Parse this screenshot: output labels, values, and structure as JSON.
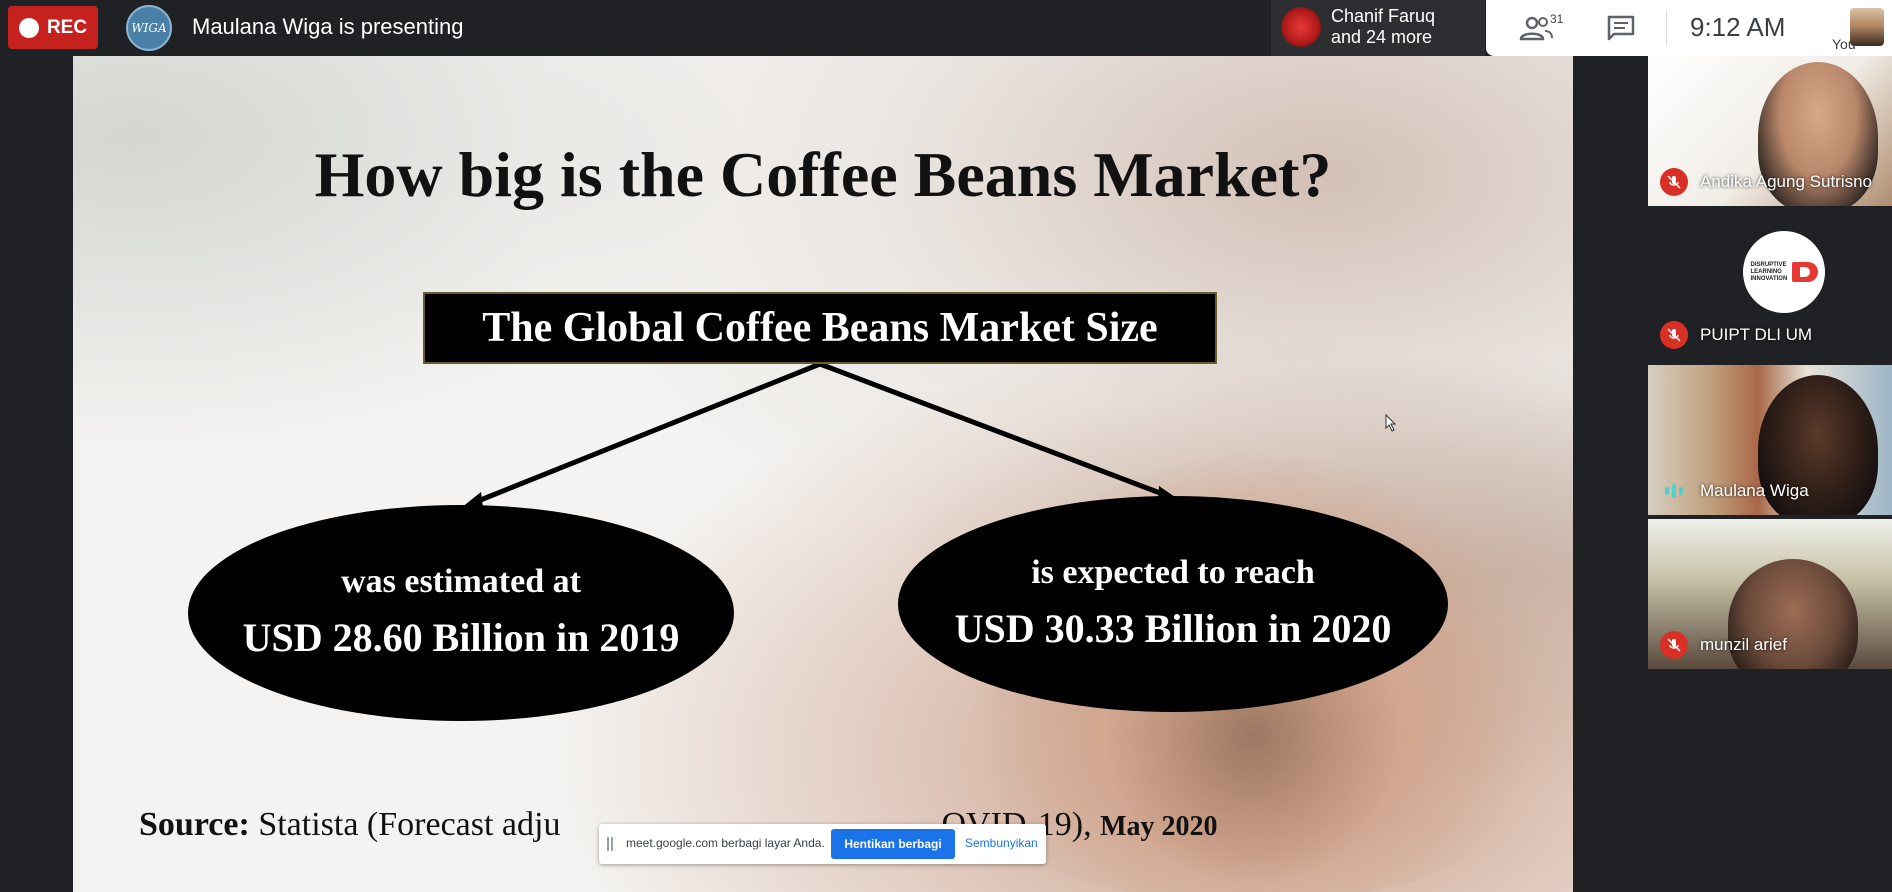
{
  "topbar": {
    "rec_label": "REC",
    "presenter_initials": "WIGA",
    "presenting_text": "Maulana Wiga is presenting",
    "speaker": {
      "line1": "Chanif Faruq",
      "line2": "and 24 more"
    },
    "people_count": "31",
    "clock": "9:12 AM",
    "self_label": "You"
  },
  "slide": {
    "title": "How big is the Coffee Beans Market?",
    "box_label": "The Global Coffee Beans Market Size",
    "left": {
      "line1": "was estimated at",
      "line2": "USD 28.60 Billion in 2019"
    },
    "right": {
      "line1": "is expected to reach",
      "line2": "USD 30.33 Billion in 2020"
    },
    "source_label": "Source:",
    "source_text": " Statista (Forecast adju",
    "source_tail": "OVID-19), ",
    "source_date": "May 2020"
  },
  "share_bar": {
    "text": "meet.google.com berbagi layar Anda.",
    "stop_label": "Hentikan berbagi",
    "hide_label": "Sembunyikan"
  },
  "participants": [
    {
      "name": "Andika Agung Sutrisno",
      "mic": "muted"
    },
    {
      "name": "PUIPT DLI UM",
      "mic": "muted",
      "logo_text": "DISRUPTIVE LEARNING INNOVATION"
    },
    {
      "name": "Maulana Wiga",
      "mic": "speaking"
    },
    {
      "name": "munzil arief",
      "mic": "muted"
    }
  ],
  "colors": {
    "rec": "#c5221f",
    "share_button": "#1a73e8",
    "muted_mic": "#d93025",
    "speaking_indicator": "#4fd1c5"
  }
}
